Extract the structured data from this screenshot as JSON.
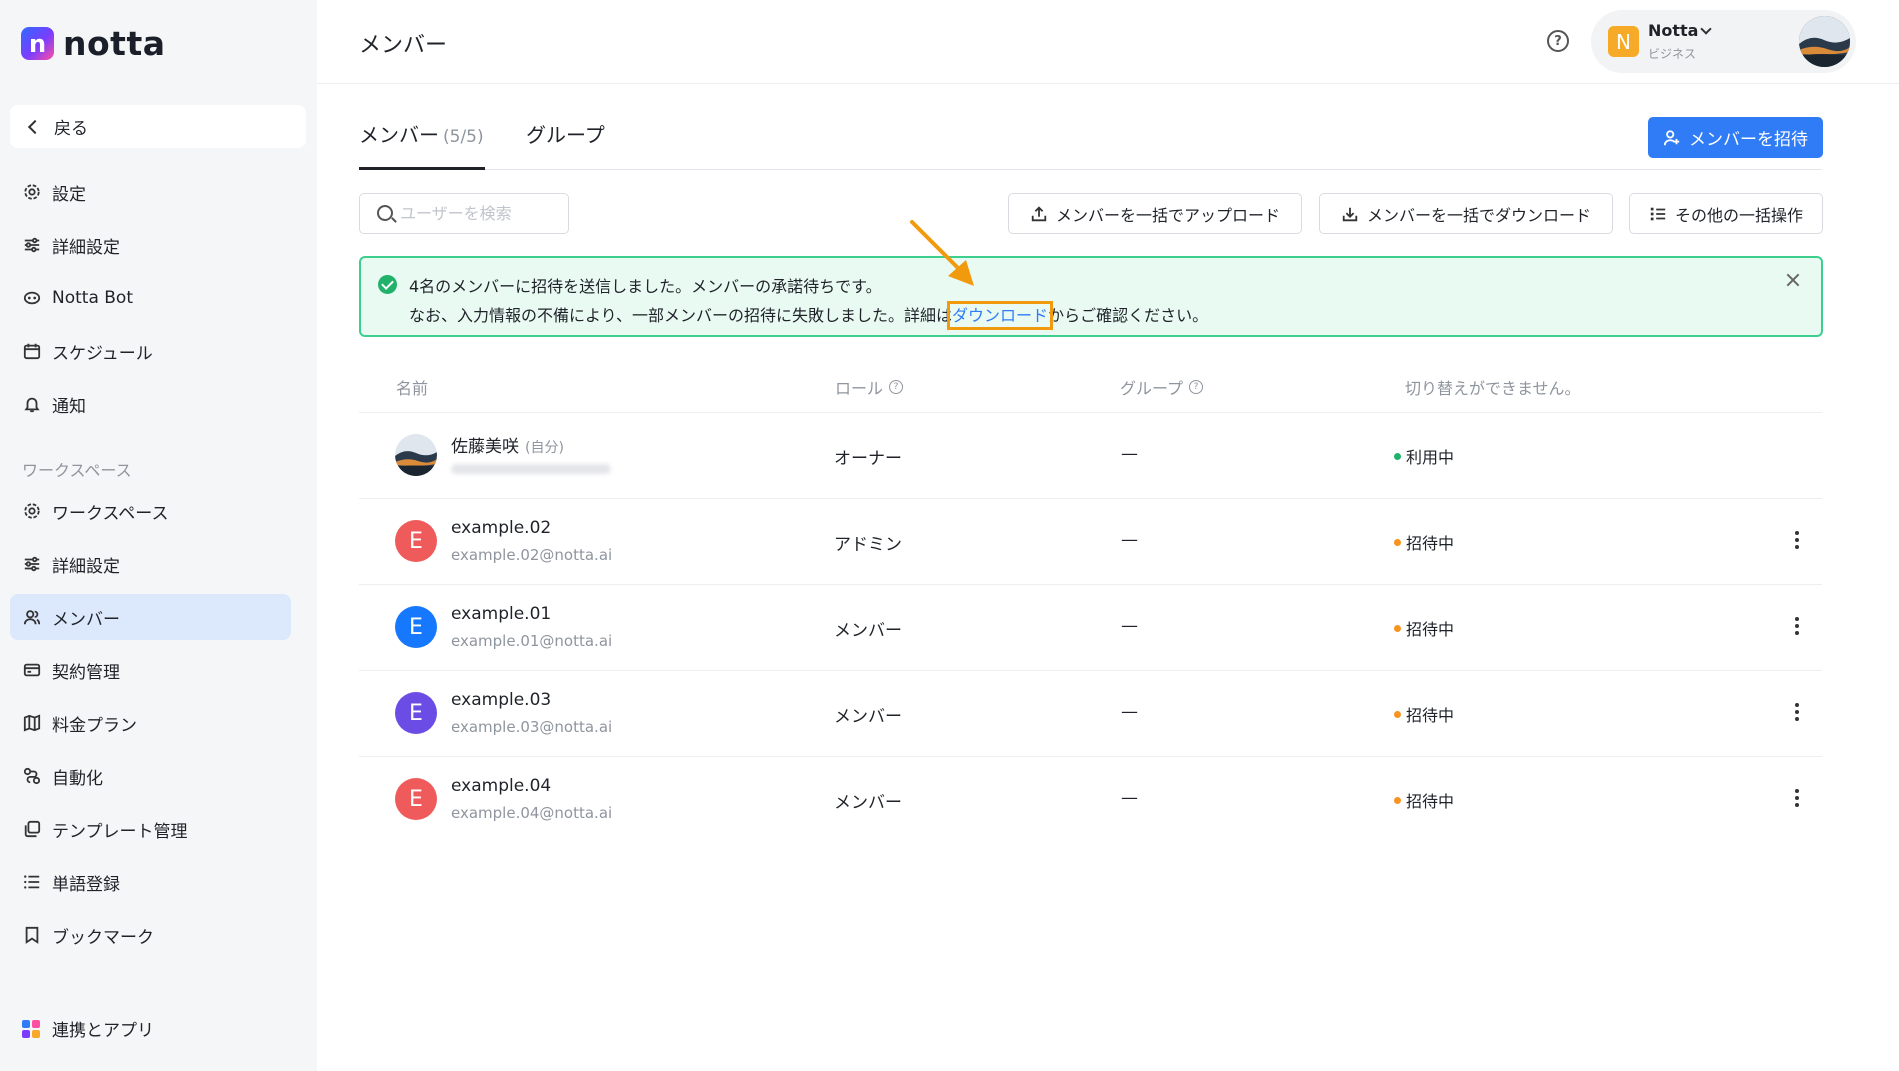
{
  "app": {
    "logo_text": "notta",
    "logo_mark": "n"
  },
  "sidebar": {
    "back_label": "戻る",
    "items_top": [
      {
        "label": "設定",
        "icon": "gear-icon"
      },
      {
        "label": "詳細設定",
        "icon": "sliders-icon"
      },
      {
        "label": "Notta Bot",
        "icon": "bot-icon"
      },
      {
        "label": "スケジュール",
        "icon": "calendar-icon"
      },
      {
        "label": "通知",
        "icon": "bell-icon"
      }
    ],
    "section_label": "ワークスペース",
    "items_workspace": [
      {
        "label": "ワークスペース",
        "icon": "gear-icon"
      },
      {
        "label": "詳細設定",
        "icon": "sliders-icon"
      },
      {
        "label": "メンバー",
        "icon": "users-icon",
        "active": true
      },
      {
        "label": "契約管理",
        "icon": "billing-icon"
      },
      {
        "label": "料金プラン",
        "icon": "map-icon"
      },
      {
        "label": "自動化",
        "icon": "automation-icon"
      },
      {
        "label": "テンプレート管理",
        "icon": "template-icon"
      },
      {
        "label": "単語登録",
        "icon": "list-icon"
      },
      {
        "label": "ブックマーク",
        "icon": "bookmark-icon"
      }
    ],
    "integrations_label": "連携とアプリ"
  },
  "header": {
    "title": "メンバー",
    "account": {
      "badge": "N",
      "name": "Notta",
      "plan": "ビジネス"
    }
  },
  "tabs": {
    "members_label": "メンバー",
    "members_count": "(5/5)",
    "groups_label": "グループ"
  },
  "invite_button": "メンバーを招待",
  "toolbar": {
    "search_placeholder": "ユーザーを検索",
    "bulk_upload": "メンバーを一括でアップロード",
    "bulk_download": "メンバーを一括でダウンロード",
    "other_bulk": "その他の一括操作"
  },
  "alert": {
    "line1": "4名のメンバーに招待を送信しました。メンバーの承諾待ちです。",
    "line2_pre": "なお、入力情報の不備により、一部メンバーの招待に失敗しました。詳細は",
    "line2_link": "ダウンロード",
    "line2_post": "からご確認ください。"
  },
  "table": {
    "headers": {
      "name": "名前",
      "role": "ロール",
      "group": "グループ",
      "status": "切り替えができません。"
    },
    "rows": [
      {
        "name": "佐藤美咲",
        "self_tag": "(自分)",
        "email": "",
        "role": "オーナー",
        "group": "—",
        "status": "利用中",
        "status_color": "#20b26b",
        "avatar_type": "photo"
      },
      {
        "name": "example.02",
        "email": "example.02@notta.ai",
        "role": "アドミン",
        "group": "—",
        "status": "招待中",
        "status_color": "#f7931e",
        "avatar_letter": "E",
        "avatar_color": "#ef5b5b"
      },
      {
        "name": "example.01",
        "email": "example.01@notta.ai",
        "role": "メンバー",
        "group": "—",
        "status": "招待中",
        "status_color": "#f7931e",
        "avatar_letter": "E",
        "avatar_color": "#1677ff"
      },
      {
        "name": "example.03",
        "email": "example.03@notta.ai",
        "role": "メンバー",
        "group": "—",
        "status": "招待中",
        "status_color": "#f7931e",
        "avatar_letter": "E",
        "avatar_color": "#6b4de6"
      },
      {
        "name": "example.04",
        "email": "example.04@notta.ai",
        "role": "メンバー",
        "group": "—",
        "status": "招待中",
        "status_color": "#f7931e",
        "avatar_letter": "E",
        "avatar_color": "#ef5b5b"
      }
    ]
  },
  "colors": {
    "accent": "#2f7cf6",
    "highlight": "#f29a0e",
    "success_bg": "#e9faf3",
    "success_border": "#3ccf8e"
  }
}
